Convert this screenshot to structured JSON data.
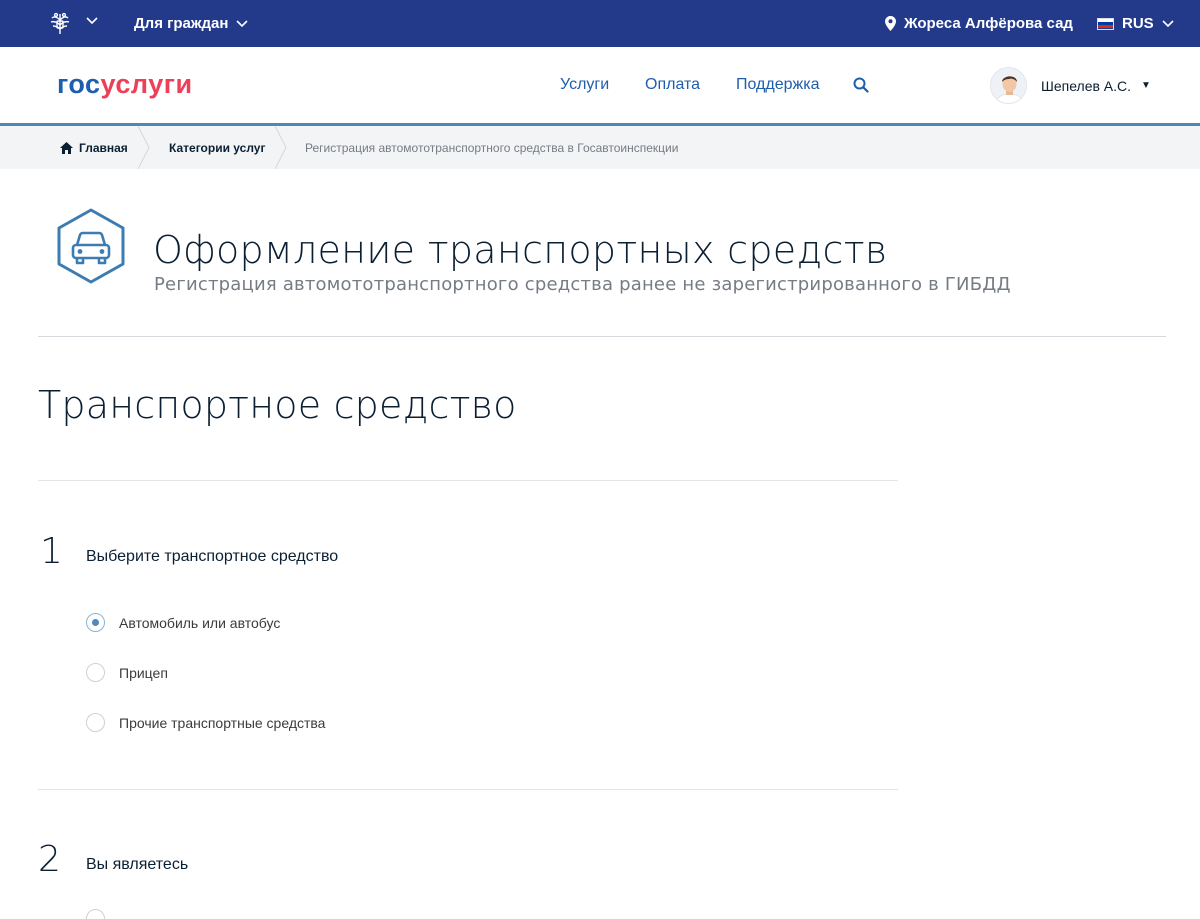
{
  "topbar": {
    "citizens_label": "Для граждан",
    "location_label": "Жореса Алфёрова сад",
    "lang_label": "RUS"
  },
  "header": {
    "logo_part1": "гос",
    "logo_part2": "услуги",
    "nav": [
      "Услуги",
      "Оплата",
      "Поддержка"
    ],
    "user_name": "Шепелев А.С."
  },
  "breadcrumbs": [
    "Главная",
    "Категории услуг",
    "Регистрация автомототранспортного средства в Госавтоинспекции"
  ],
  "service": {
    "title": "Оформление транспортных средств",
    "subtitle": "Регистрация автомототранспортного средства ранее не зарегистрированного в ГИБДД"
  },
  "form": {
    "section_title": "Транспортное средство",
    "steps": [
      {
        "number": "1",
        "label": "Выберите транспортное средство",
        "options": [
          "Автомобиль или автобус",
          "Прицеп",
          "Прочие транспортные средства"
        ],
        "selected": "Автомобиль или автобус"
      },
      {
        "number": "2",
        "label": "Вы являетесь"
      }
    ]
  },
  "colors": {
    "topbar": "#233a8b",
    "logo_blue": "#1f5ead",
    "logo_red": "#ee3f58",
    "link": "#1f5ead",
    "accent_line": "#4b8ab8",
    "radio_dot": "#4d8ac0"
  }
}
